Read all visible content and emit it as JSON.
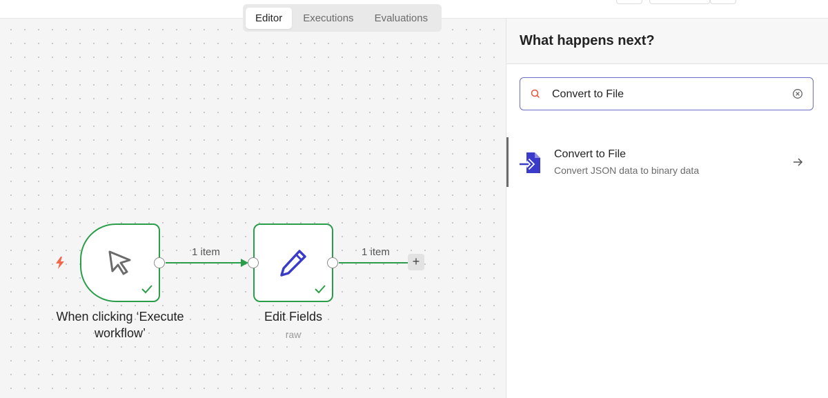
{
  "tabs": [
    {
      "label": "Editor",
      "active": true
    },
    {
      "label": "Executions",
      "active": false
    },
    {
      "label": "Evaluations",
      "active": false
    }
  ],
  "canvas": {
    "nodes": [
      {
        "id": "trigger",
        "label": "When clicking ‘Execute workflow’",
        "label_lines": [
          "When clicking ‘Execute",
          "workflow’"
        ],
        "icon": "cursor-icon",
        "status": "success"
      },
      {
        "id": "edit",
        "label": "Edit Fields",
        "subtitle": "raw",
        "icon": "pencil-icon",
        "status": "success"
      }
    ],
    "edges": [
      {
        "from": "trigger",
        "to": "edit",
        "label": "1 item"
      },
      {
        "from": "edit",
        "to": "add",
        "label": "1 item"
      }
    ],
    "add_button": "+"
  },
  "panel": {
    "title": "What happens next?",
    "search": {
      "value": "Convert to File",
      "placeholder": "Search nodes..."
    },
    "results": [
      {
        "title": "Convert to File",
        "description": "Convert JSON data to binary data",
        "icon": "convert-to-file-icon"
      }
    ]
  },
  "colors": {
    "success": "#2a9d4a",
    "accent": "#6b6bc8",
    "trigger_bolt": "#f2684a",
    "pencil": "#3b3bc9",
    "canvas_bg": "#f5f5f5"
  }
}
